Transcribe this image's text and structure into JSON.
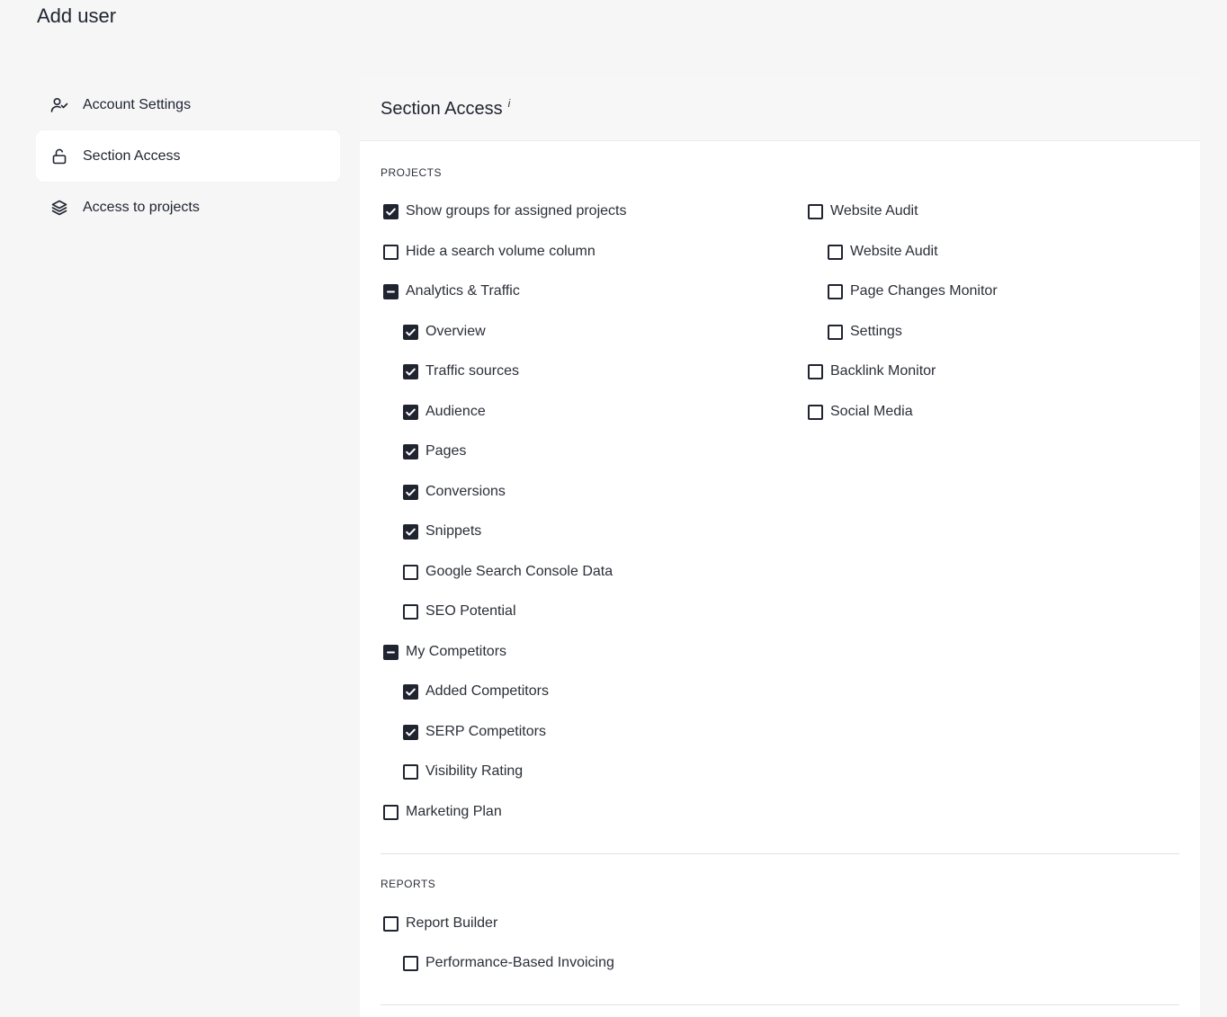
{
  "page": {
    "title": "Add user"
  },
  "sidebar": {
    "items": [
      {
        "label": "Account Settings",
        "icon": "user-check-icon"
      },
      {
        "label": "Section Access",
        "icon": "unlock-icon",
        "active": true
      },
      {
        "label": "Access to projects",
        "icon": "layers-icon"
      }
    ]
  },
  "panel": {
    "title": "Section Access",
    "info": "i",
    "projects_label": "PROJECTS",
    "reports_label": "REPORTS",
    "projects_left": [
      {
        "label": "Show groups for assigned projects",
        "state": "checked"
      },
      {
        "label": "Hide a search volume column",
        "state": "unchecked"
      },
      {
        "label": "Analytics & Traffic",
        "state": "indeterminate"
      },
      {
        "label": "Overview",
        "state": "checked"
      },
      {
        "label": "Traffic sources",
        "state": "checked"
      },
      {
        "label": "Audience",
        "state": "checked"
      },
      {
        "label": "Pages",
        "state": "checked"
      },
      {
        "label": "Conversions",
        "state": "checked"
      },
      {
        "label": "Snippets",
        "state": "checked"
      },
      {
        "label": "Google Search Console Data",
        "state": "unchecked"
      },
      {
        "label": "SEO Potential",
        "state": "unchecked"
      },
      {
        "label": "My Competitors",
        "state": "indeterminate"
      },
      {
        "label": "Added Competitors",
        "state": "checked"
      },
      {
        "label": "SERP Competitors",
        "state": "checked"
      },
      {
        "label": "Visibility Rating",
        "state": "unchecked"
      },
      {
        "label": "Marketing Plan",
        "state": "unchecked"
      }
    ],
    "projects_right": [
      {
        "label": "Website Audit",
        "state": "unchecked"
      },
      {
        "label": "Website Audit",
        "state": "unchecked"
      },
      {
        "label": "Page Changes Monitor",
        "state": "unchecked"
      },
      {
        "label": "Settings",
        "state": "unchecked"
      },
      {
        "label": "Backlink Monitor",
        "state": "unchecked"
      },
      {
        "label": "Social Media",
        "state": "unchecked"
      }
    ],
    "reports": [
      {
        "label": "Report Builder",
        "state": "unchecked"
      },
      {
        "label": "Performance-Based Invoicing",
        "state": "unchecked"
      }
    ]
  }
}
